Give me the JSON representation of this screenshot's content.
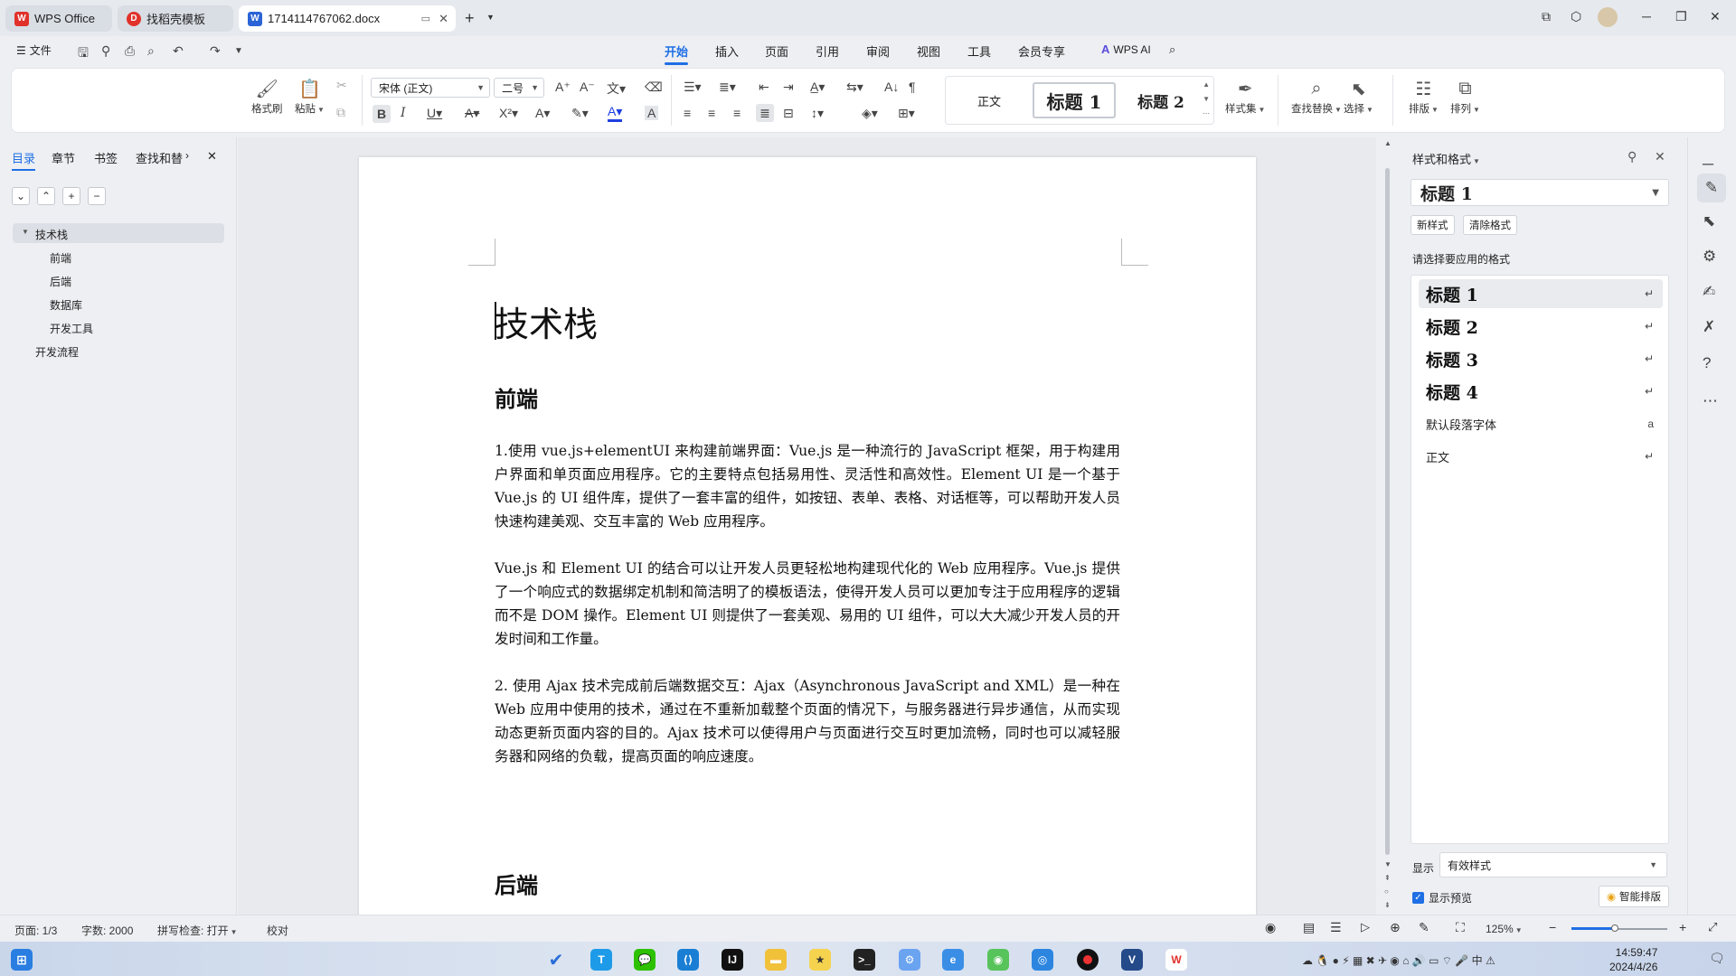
{
  "tabs": [
    {
      "label": "WPS Office",
      "logo": "W"
    },
    {
      "label": "找稻壳模板",
      "logo": "D"
    },
    {
      "label": "1714114767062.docx",
      "logo": "W"
    }
  ],
  "menu": {
    "file": "文件",
    "tabs": [
      "开始",
      "插入",
      "页面",
      "引用",
      "审阅",
      "视图",
      "工具",
      "会员专享"
    ],
    "active_tab": "开始",
    "ai": "WPS AI"
  },
  "ribbon": {
    "format_painter": "格式刷",
    "paste": "粘贴",
    "font_name": "宋体 (正文)",
    "font_size": "二号",
    "styles": [
      "正文",
      "标题 1",
      "标题 2"
    ],
    "style_set": "样式集",
    "find_replace": "查找替换",
    "select": "选择",
    "typeset": "排版",
    "arrange": "排列"
  },
  "nav": {
    "tabs": [
      "目录",
      "章节",
      "书签",
      "查找和替"
    ],
    "toc": [
      {
        "label": "技术栈",
        "level": 1,
        "expanded": true
      },
      {
        "label": "前端",
        "level": 2
      },
      {
        "label": "后端",
        "level": 2
      },
      {
        "label": "数据库",
        "level": 2
      },
      {
        "label": "开发工具",
        "level": 2
      },
      {
        "label": "开发流程",
        "level": 1
      }
    ]
  },
  "document": {
    "title": "技术栈",
    "h_frontend": "前端",
    "p1": "1.使用 vue.js+elementUI 来构建前端界面：Vue.js 是一种流行的 JavaScript 框架，用于构建用户界面和单页面应用程序。它的主要特点包括易用性、灵活性和高效性。Element UI 是一个基于 Vue.js 的 UI 组件库，提供了一套丰富的组件，如按钮、表单、表格、对话框等，可以帮助开发人员快速构建美观、交互丰富的 Web 应用程序。",
    "p2": "Vue.js 和 Element UI 的结合可以让开发人员更轻松地构建现代化的 Web 应用程序。Vue.js 提供了一个响应式的数据绑定机制和简洁明了的模板语法，使得开发人员可以更加专注于应用程序的逻辑而不是 DOM 操作。Element UI 则提供了一套美观、易用的 UI 组件，可以大大减少开发人员的开发时间和工作量。",
    "p3": "2. 使用 Ajax 技术完成前后端数据交互：Ajax（Asynchronous JavaScript and XML）是一种在 Web 应用中使用的技术，通过在不重新加载整个页面的情况下，与服务器进行异步通信，从而实现动态更新页面内容的目的。Ajax 技术可以使得用户与页面进行交互时更加流畅，同时也可以减轻服务器和网络的负载，提高页面的响应速度。",
    "h_backend": "后端"
  },
  "styles_panel": {
    "title": "样式和格式",
    "current": "标题 1",
    "new_style": "新样式",
    "clear_format": "清除格式",
    "prompt": "请选择要应用的格式",
    "items": [
      "标题 1",
      "标题 2",
      "标题 3",
      "标题 4",
      "默认段落字体",
      "正文"
    ],
    "show_label": "显示",
    "show_value": "有效样式",
    "preview": "显示预览",
    "smart": "智能排版"
  },
  "status": {
    "page": "页面: 1/3",
    "words": "字数: 2000",
    "spell": "拼写检查: 打开",
    "proof": "校对",
    "zoom": "125%",
    "zoom_level": 0.45
  },
  "clock": {
    "time": "14:59:47",
    "date": "2024/4/26"
  },
  "colors": {
    "accent": "#1f6fe5",
    "wps_red": "#e0322b"
  }
}
